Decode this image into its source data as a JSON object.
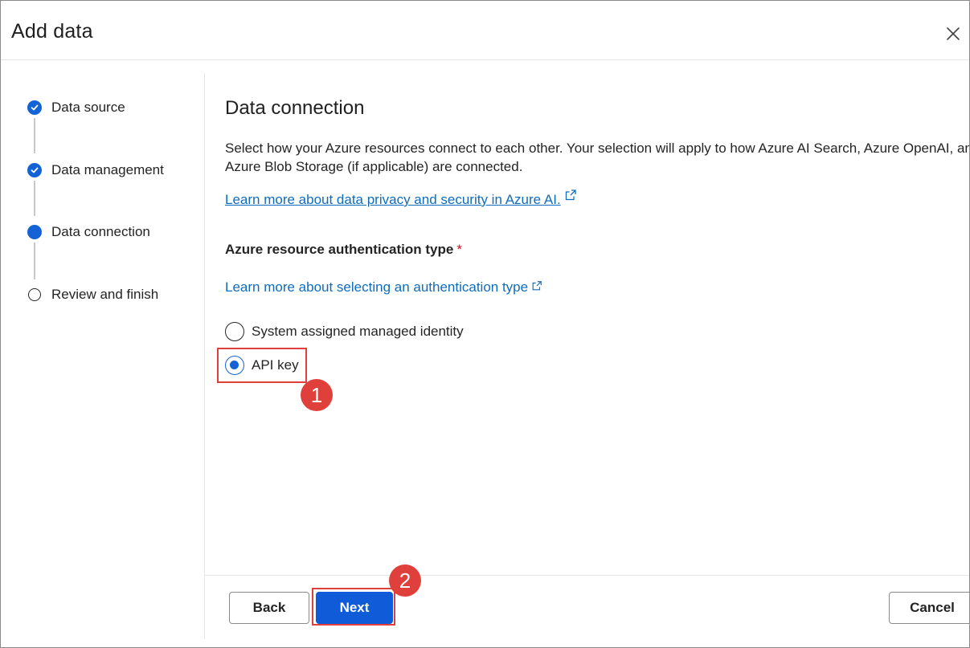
{
  "dialog": {
    "title": "Add data",
    "close_icon": "close-icon"
  },
  "steps": [
    {
      "label": "Data source",
      "state": "done"
    },
    {
      "label": "Data management",
      "state": "done"
    },
    {
      "label": "Data connection",
      "state": "current"
    },
    {
      "label": "Review and finish",
      "state": "pending"
    }
  ],
  "main": {
    "title": "Data connection",
    "description": "Select how your Azure resources connect to each other. Your selection will apply to how Azure AI Search, Azure OpenAI, and Azure Blob Storage (if applicable) are connected.",
    "privacy_link": "Learn more about data privacy and security in Azure AI.",
    "auth_label": "Azure resource authentication type",
    "required_marker": "*",
    "auth_link": "Learn more about selecting an authentication type",
    "options": [
      {
        "label": "System assigned managed identity",
        "checked": false
      },
      {
        "label": "API key",
        "checked": true
      }
    ]
  },
  "annotations": {
    "badge_1": "1",
    "badge_2": "2",
    "color": "#e0403c"
  },
  "footer": {
    "back_label": "Back",
    "next_label": "Next",
    "cancel_label": "Cancel"
  },
  "colors": {
    "accent": "#1463d6",
    "primary_button": "#0f5bd8",
    "link": "#0f6cbd",
    "required": "#c50f1f"
  }
}
